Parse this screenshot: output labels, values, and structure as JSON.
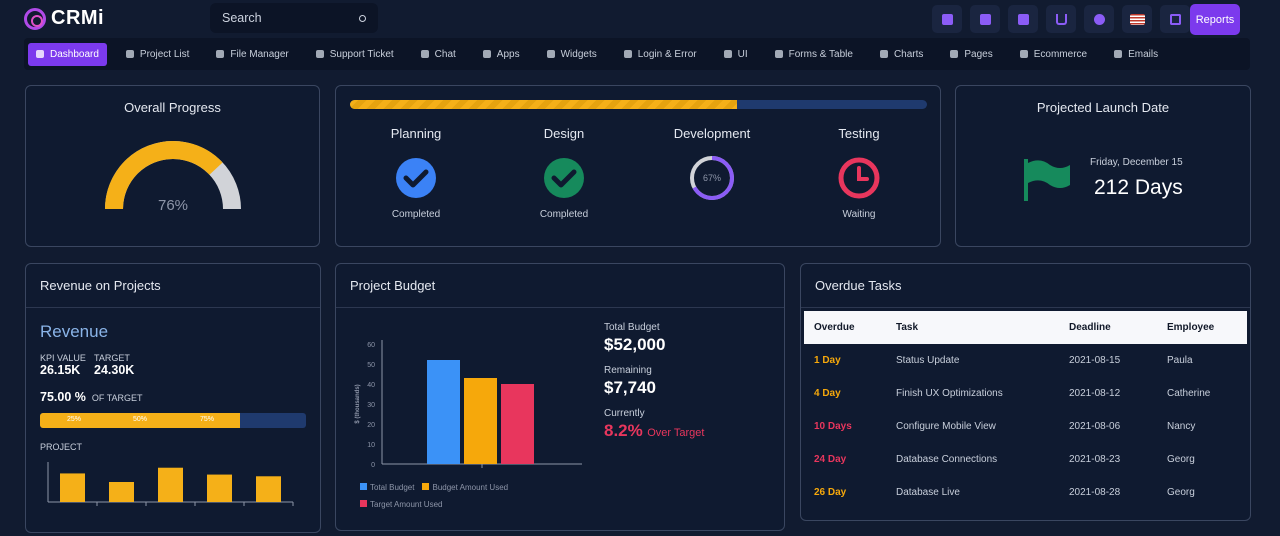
{
  "header": {
    "logo": "CRMi",
    "search_placeholder": "Search",
    "reports": "Reports",
    "icons": [
      "bell-icon",
      "grid-icon",
      "folder-icon",
      "cart-icon",
      "chat-icon",
      "us-flag-icon",
      "expand-icon"
    ]
  },
  "nav": {
    "items": [
      {
        "label": "Dashboard",
        "icon": "dashboard-icon",
        "active": true
      },
      {
        "label": "Project List",
        "icon": "cube-icon"
      },
      {
        "label": "File Manager",
        "icon": "folder-icon"
      },
      {
        "label": "Support Ticket",
        "icon": "ticket-icon"
      },
      {
        "label": "Chat",
        "icon": "chat-icon"
      },
      {
        "label": "Apps",
        "icon": "bulb-icon"
      },
      {
        "label": "Widgets",
        "icon": "widget-icon"
      },
      {
        "label": "Login & Error",
        "icon": "lock-icon"
      },
      {
        "label": "UI",
        "icon": "ui-icon"
      },
      {
        "label": "Forms & Table",
        "icon": "form-icon"
      },
      {
        "label": "Charts",
        "icon": "chart-icon"
      },
      {
        "label": "Pages",
        "icon": "page-icon"
      },
      {
        "label": "Ecommerce",
        "icon": "shop-icon"
      },
      {
        "label": "Emails",
        "icon": "mail-icon"
      }
    ]
  },
  "overall": {
    "title": "Overall Progress",
    "value_text": "76%",
    "value": 0.76,
    "colors": {
      "fill": "#f5b018",
      "track": "#d1d3d8"
    }
  },
  "stages": {
    "progress": 0.67,
    "items": [
      {
        "name": "Planning",
        "status": "Completed",
        "icon": "check-circle-icon",
        "color": "#3b82f6"
      },
      {
        "name": "Design",
        "status": "Completed",
        "icon": "check-circle-icon",
        "color": "#168a5c"
      },
      {
        "name": "Development",
        "status": "",
        "icon": "progress-ring-icon",
        "ring_text": "67%",
        "ring_value": 0.67,
        "color": "#8b5cf6"
      },
      {
        "name": "Testing",
        "status": "Waiting",
        "icon": "clock-icon",
        "color": "#e8365d"
      }
    ]
  },
  "launch": {
    "title": "Projected Launch Date",
    "date": "Friday, December 15",
    "days": "212 Days",
    "icon": "flag-icon",
    "flag_color": "#168a5c"
  },
  "revenue": {
    "title": "Revenue on Projects",
    "subtitle": "Revenue",
    "kpi_label": "KPI VALUE",
    "kpi_value": "26.15K",
    "target_label": "TARGET",
    "target_value": "24.30K",
    "pct": "75.00 %",
    "pct_label": "OF TARGET",
    "bar_value": 0.75,
    "bar_ticks": [
      "25%",
      "50%",
      "75%"
    ],
    "project_label": "PROJECT",
    "project_values": [
      5,
      3.5,
      6,
      4.8,
      4.5
    ],
    "bar_color": "#f5b018"
  },
  "budget": {
    "title": "Project Budget",
    "total_label": "Total Budget",
    "total": "$52,000",
    "remaining_label": "Remaining",
    "remaining": "$7,740",
    "current_label": "Currently",
    "current_pct": "8.2%",
    "current_text": "Over Target",
    "chart_data": {
      "type": "bar",
      "ylabel": "$ (thousands)",
      "ylim": [
        0,
        60
      ],
      "yticks": [
        0,
        10,
        20,
        30,
        40,
        50,
        60
      ],
      "series": [
        {
          "name": "Total Budget",
          "values": [
            52
          ],
          "color": "#3b92f7"
        },
        {
          "name": "Budget Amount Used",
          "values": [
            43
          ],
          "color": "#f6a80b"
        },
        {
          "name": "Target Amount Used",
          "values": [
            40
          ],
          "color": "#e8365d"
        }
      ]
    }
  },
  "overdue": {
    "title": "Overdue Tasks",
    "columns": [
      "Overdue",
      "Task",
      "Deadline",
      "Employee"
    ],
    "rows": [
      {
        "overdue": "1 Day",
        "task": "Status Update",
        "deadline": "2021-08-15",
        "employee": "Paula",
        "color": "#f6a80b"
      },
      {
        "overdue": "4 Day",
        "task": "Finish UX Optimizations",
        "deadline": "2021-08-12",
        "employee": "Catherine",
        "color": "#f6a80b"
      },
      {
        "overdue": "10 Days",
        "task": "Configure Mobile View",
        "deadline": "2021-08-06",
        "employee": "Nancy",
        "color": "#e8365d"
      },
      {
        "overdue": "24 Day",
        "task": "Database Connections",
        "deadline": "2021-08-23",
        "employee": "Georg",
        "color": "#e8365d"
      },
      {
        "overdue": "26 Day",
        "task": "Database Live",
        "deadline": "2021-08-28",
        "employee": "Georg",
        "color": "#f6a80b"
      }
    ]
  }
}
